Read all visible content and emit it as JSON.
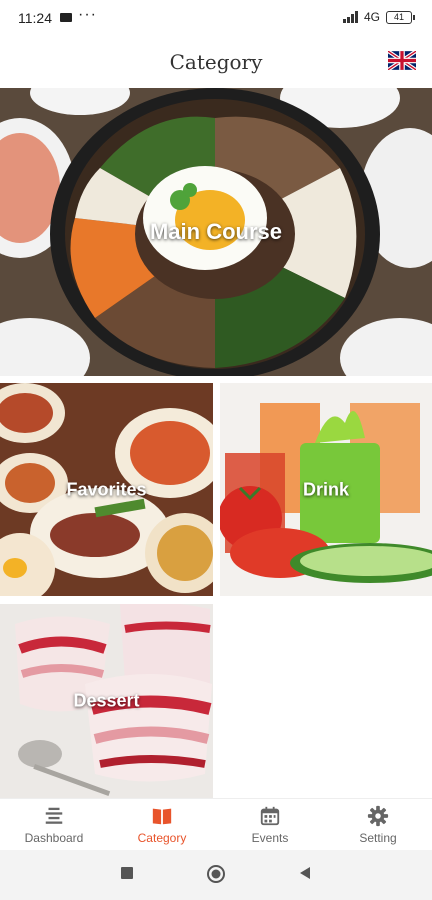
{
  "status": {
    "time": "11:24",
    "network": "4G",
    "battery": "41"
  },
  "header": {
    "title": "Category",
    "language_flag": "uk-flag-icon"
  },
  "categories": [
    {
      "label": "Main Course"
    },
    {
      "label": "Favorites"
    },
    {
      "label": "Drink"
    },
    {
      "label": "Dessert"
    }
  ],
  "tabbar": {
    "accent_color": "#e8542b",
    "items": [
      {
        "label": "Dashboard",
        "icon": "dashboard-icon",
        "active": false
      },
      {
        "label": "Category",
        "icon": "book-icon",
        "active": true
      },
      {
        "label": "Events",
        "icon": "calendar-icon",
        "active": false
      },
      {
        "label": "Setting",
        "icon": "gear-icon",
        "active": false
      }
    ]
  }
}
